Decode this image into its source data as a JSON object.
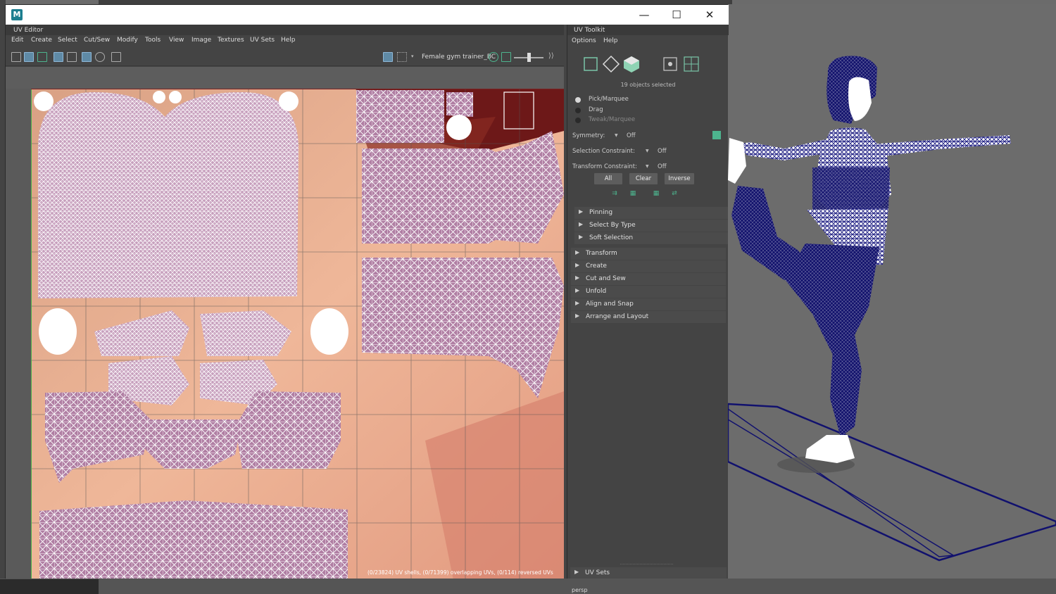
{
  "window": {
    "logo": "M",
    "controls": {
      "minimize": "—",
      "maximize": "☐",
      "close": "✕"
    }
  },
  "uv_editor": {
    "title": "UV Editor",
    "menu": [
      "Edit",
      "Create",
      "Select",
      "Cut/Sew",
      "Modify",
      "Tools",
      "View",
      "Image",
      "Textures",
      "UV Sets",
      "Help"
    ],
    "image_name": "Female gym trainer_BC",
    "status": "(0/23824) UV shells, (0/71399) overlapping UVs, (0/114) reversed UVs"
  },
  "uv_toolkit": {
    "title": "UV Toolkit",
    "menu": [
      "Options",
      "Help"
    ],
    "objects_selected": "19 objects selected",
    "modes": [
      {
        "label": "Pick/Marquee",
        "selected": true,
        "enabled": true
      },
      {
        "label": "Drag",
        "selected": false,
        "enabled": true
      },
      {
        "label": "Tweak/Marquee",
        "selected": false,
        "enabled": false
      }
    ],
    "symmetry": {
      "label": "Symmetry:",
      "value": "Off"
    },
    "selection_constraint": {
      "label": "Selection Constraint:",
      "value": "Off"
    },
    "transform_constraint": {
      "label": "Transform Constraint:",
      "value": "Off"
    },
    "buttons": {
      "all": "All",
      "clear": "Clear",
      "inverse": "Inverse"
    },
    "sub_sections": [
      "Pinning",
      "Select By Type",
      "Soft Selection"
    ],
    "sections": [
      "Transform",
      "Create",
      "Cut and Sew",
      "Unfold",
      "Align and Snap",
      "Arrange and Layout"
    ],
    "uv_sets_section": "UV Sets"
  },
  "viewport": {
    "camera_label": "persp"
  },
  "colors": {
    "accent": "#5f8aa6",
    "wire_blue": "#13137a",
    "uv_wire": "#ffffff",
    "toolkit_icon_green": "#4db48e"
  }
}
